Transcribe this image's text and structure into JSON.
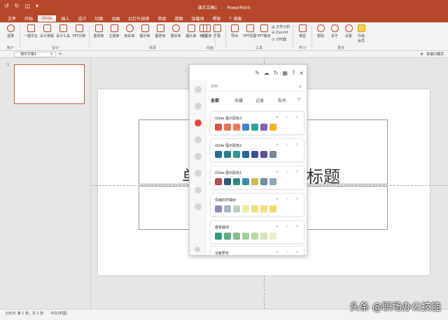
{
  "window": {
    "doc_name": "演示文稿1",
    "separator": "-",
    "app_name": "PowerPoint",
    "quick_access": [
      "↺",
      "↻",
      "◫",
      "▾"
    ]
  },
  "menu": {
    "tabs": [
      "文件",
      "开始",
      "iSlide",
      "插入",
      "设计",
      "切换",
      "动画",
      "幻灯片放映",
      "审阅",
      "视图",
      "加载项",
      "帮助"
    ],
    "active_index": 2,
    "search_label": "搜索"
  },
  "ribbon": {
    "buttons": {
      "login": "登录",
      "optimize": "一键优化",
      "design_layout": "设计排版",
      "design_tools": "设计工具",
      "ppt_diag": "PPT诊断",
      "case_lib": "案例库",
      "theme_lib": "主题库",
      "color_lib": "色彩库",
      "icon_lib": "图示库",
      "chart_lib": "图表库",
      "icon_lib2": "图标库",
      "image_lib": "图片库",
      "illust_lib": "插图库",
      "add_anim": "补间",
      "extend": "扩展",
      "export": "导出",
      "ppt_split": "PPT拆图",
      "ppt_thin": "PPT瘦身",
      "file_analysis": "文件分析",
      "zoomit": "ZoomIt",
      "timer": "计时器",
      "class": "课堂",
      "help": "帮助",
      "about": "关于",
      "settings": "设置",
      "upgrade_l1": "升级",
      "upgrade_l2": "会员"
    },
    "groups": {
      "account": "账户",
      "design": "设计",
      "resources": "资源",
      "animation": "动画",
      "tools": "工具",
      "learn": "学习",
      "more": "更多"
    }
  },
  "docbar": {
    "tab": "演示文稿1",
    "close": "×",
    "add": "+",
    "mode": "多窗口模式"
  },
  "slides": {
    "thumb_number": "1",
    "title_left": "单",
    "title_right": "标题"
  },
  "status": {
    "slide_info": "幻灯片 第 1 张，共 1 张",
    "language": "中文(中国)",
    "watermark": "头条 @职场办公技能"
  },
  "panel": {
    "search_placeholder": "搜索...",
    "filters": [
      "全部",
      "收藏",
      "记录",
      "私有"
    ],
    "filter_caret": "⌄",
    "cards": [
      {
        "name": "iSlide 图示配色3",
        "colors": [
          "#e0504a",
          "#eb6f50",
          "#f07a56",
          "#3f83c6",
          "#2aa399",
          "#8a5bb0",
          "#f0b51c"
        ]
      },
      {
        "name": "iSlide 图示配色2",
        "colors": [
          "#2b6a9a",
          "#2a7d8a",
          "#2d9c8c",
          "#2b5f9e",
          "#3a4fa0",
          "#5e4f9a",
          "#768896"
        ]
      },
      {
        "name": "iSlide 图示配色1",
        "colors": [
          "#b84a52",
          "#2b5a7b",
          "#2f8c7e",
          "#3d8ca8",
          "#d8b84d",
          "#6d8f9c",
          "#8aaab8"
        ]
      },
      {
        "name": "情绪的柠檬树",
        "colors": [
          "#8e88b8",
          "#a4b3c0",
          "#b9d0c2",
          "#edef9d",
          "#e8e27c",
          "#f0df7e",
          "#f3da6a"
        ]
      },
      {
        "name": "春季曲线",
        "colors": [
          "#2f9c7f",
          "#57af86",
          "#7dc08a",
          "#9fd09a",
          "#b9d8a6",
          "#d2e3b4",
          "#e6eec4"
        ]
      },
      {
        "name": "淡紫质花",
        "colors": []
      }
    ]
  }
}
